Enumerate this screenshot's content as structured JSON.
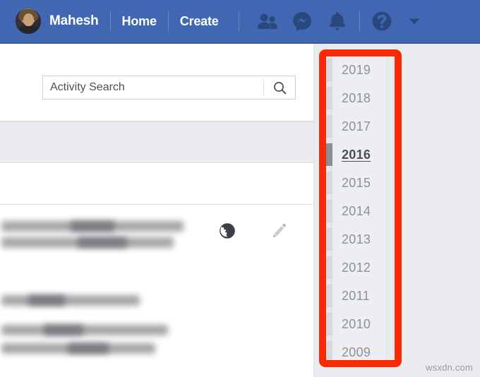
{
  "topbar": {
    "profile_name": "Mahesh",
    "avatar_name": "user-avatar",
    "links": [
      {
        "label": "Home"
      },
      {
        "label": "Create"
      }
    ],
    "icons": [
      {
        "name": "friend-requests-icon",
        "title": "Friend Requests"
      },
      {
        "name": "messenger-icon",
        "title": "Messenger"
      },
      {
        "name": "notifications-bell-icon",
        "title": "Notifications"
      },
      {
        "name": "help-icon",
        "title": "Help"
      },
      {
        "name": "account-dropdown-caret-icon",
        "title": "Account"
      }
    ],
    "background_color": "#4267b2"
  },
  "search": {
    "value": "Activity Search",
    "placeholder": "Activity Search",
    "button_name": "search-icon"
  },
  "post": {
    "privacy_icon": "globe-public-icon",
    "edit_icon": "pencil-edit-icon",
    "redacted": true
  },
  "year_filter": {
    "selected": "2016",
    "years": [
      {
        "label": "2019",
        "selected": false
      },
      {
        "label": "2018",
        "selected": false
      },
      {
        "label": "2017",
        "selected": false
      },
      {
        "label": "2016",
        "selected": true
      },
      {
        "label": "2015",
        "selected": false
      },
      {
        "label": "2014",
        "selected": false
      },
      {
        "label": "2013",
        "selected": false
      },
      {
        "label": "2012",
        "selected": false
      },
      {
        "label": "2011",
        "selected": false
      },
      {
        "label": "2010",
        "selected": false
      },
      {
        "label": "2009",
        "selected": false
      }
    ]
  },
  "annotation": {
    "color": "#f82a02",
    "shape": "rounded-rectangle",
    "target": "year-filter-panel"
  },
  "watermark": {
    "text": "wsxdn.com"
  }
}
